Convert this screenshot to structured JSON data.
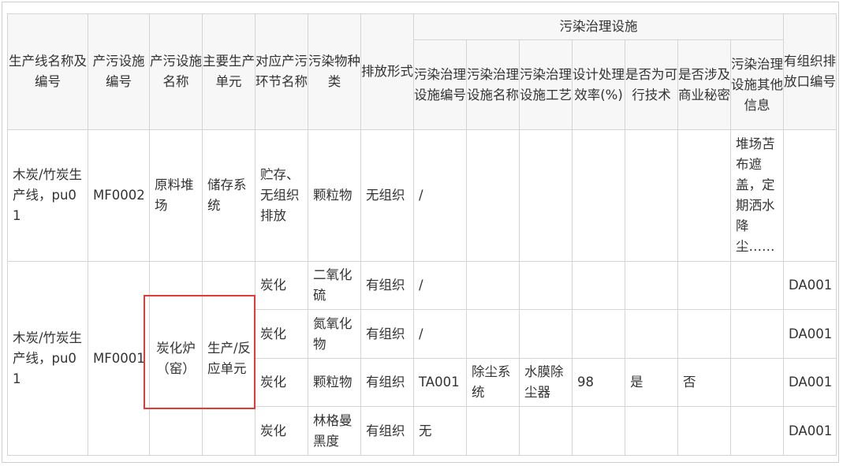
{
  "header": {
    "group_label": "污染治理设施",
    "columns": [
      "生产线名称及编号",
      "产污设施编号",
      "产污设施名称",
      "主要生产单元",
      "对应产污环节名称",
      "污染物种类",
      "排放形式",
      "污染治理设施编号",
      "污染治理设施名称",
      "污染治理设施工艺",
      "设计处理效率(%)",
      "是否为可行技术",
      "是否涉及商业秘密",
      "污染治理设施其他信息",
      "有组织排放口编号"
    ]
  },
  "group1": {
    "line": "木炭/竹炭生产线，pu01",
    "facility_id": "MF0002",
    "facility_name": "原料堆场",
    "unit": "储存系统",
    "stage": "贮存、无组织排放",
    "pollutant": "颗粒物",
    "emission": "无组织",
    "treat_id": "/",
    "other_info": "堆场苫布遮盖，定期洒水降尘……"
  },
  "group2": {
    "line": "木炭/竹炭生产线，pu01",
    "facility_id": "MF0001",
    "facility_name": "炭化炉（窑）",
    "unit": "生产/反应单元",
    "rows": [
      {
        "stage": "炭化",
        "pollutant": "二氧化硫",
        "emission": "有组织",
        "treat_id": "/",
        "treat_name": "",
        "treat_process": "",
        "efficiency": "",
        "feasible": "",
        "secret": "",
        "outlet": "DA001"
      },
      {
        "stage": "炭化",
        "pollutant": "氮氧化物",
        "emission": "有组织",
        "treat_id": "/",
        "treat_name": "",
        "treat_process": "",
        "efficiency": "",
        "feasible": "",
        "secret": "",
        "outlet": "DA001"
      },
      {
        "stage": "炭化",
        "pollutant": "颗粒物",
        "emission": "有组织",
        "treat_id": "TA001",
        "treat_name": "除尘系统",
        "treat_process": "水膜除尘器",
        "efficiency": "98",
        "feasible": "是",
        "secret": "否",
        "outlet": "DA001"
      },
      {
        "stage": "炭化",
        "pollutant": "林格曼黑度",
        "emission": "有组织",
        "treat_id": "无",
        "treat_name": "",
        "treat_process": "",
        "efficiency": "",
        "feasible": "",
        "secret": "",
        "outlet": "DA001"
      }
    ]
  }
}
